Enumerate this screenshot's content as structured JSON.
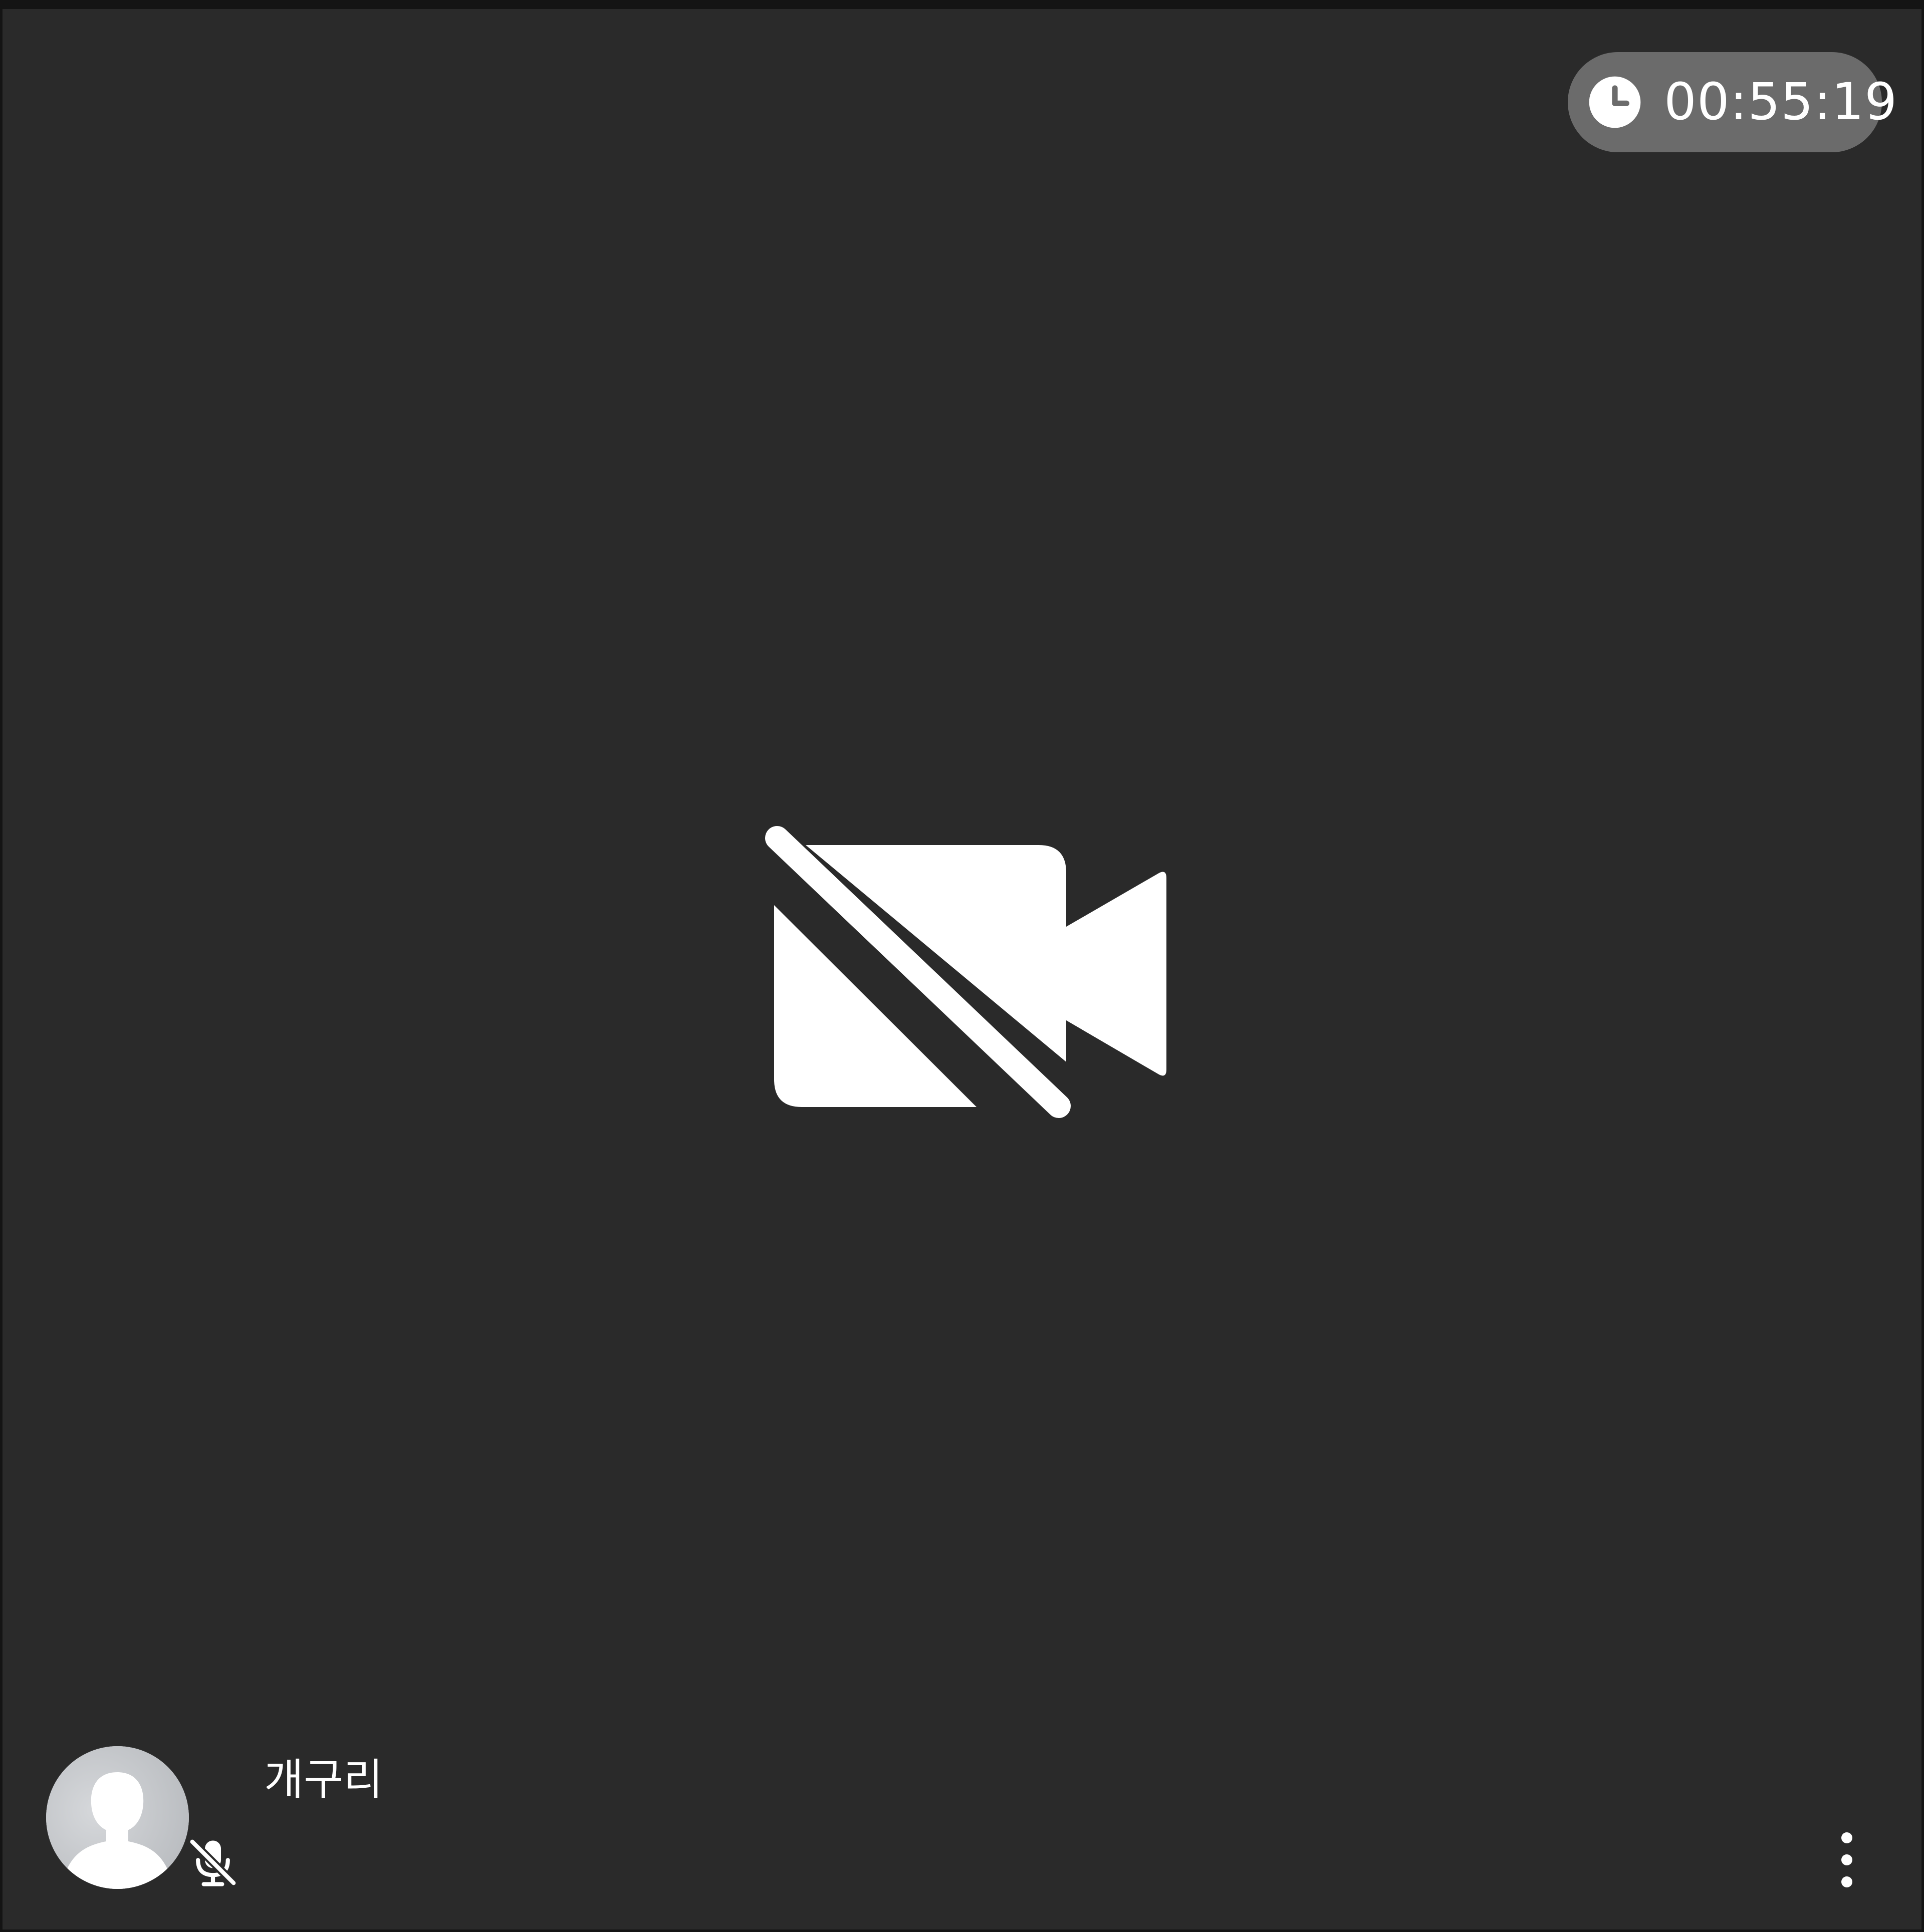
{
  "call": {
    "elapsed_time": "00:55:19",
    "timer_icon": "clock-icon",
    "video_state_icon": "video-off-icon"
  },
  "participant": {
    "name": "개구리",
    "avatar_icon": "person-silhouette-icon",
    "mic_state_icon": "mic-off-icon"
  },
  "controls": {
    "more_icon": "more-vertical-icon"
  },
  "colors": {
    "tile_background": "#2a2a2a",
    "timer_pill": "#6b6b6b",
    "foreground": "#ffffff",
    "avatar_background": "#c9cbce"
  }
}
